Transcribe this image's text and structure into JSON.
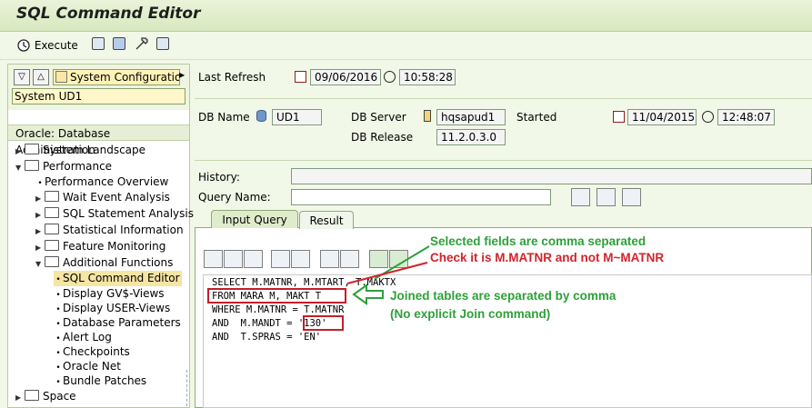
{
  "app": {
    "title": "SQL Command Editor"
  },
  "toolbar": {
    "execute_label": "Execute"
  },
  "nav": {
    "system_config": "System Configuratio",
    "system_selected": "System UD1",
    "header": "Oracle: Database Administration",
    "tree": [
      {
        "label": "System Landscape"
      },
      {
        "label": "Performance"
      },
      {
        "label": "Performance Overview"
      },
      {
        "label": "Wait Event Analysis"
      },
      {
        "label": "SQL Statement Analysis"
      },
      {
        "label": "Statistical Information"
      },
      {
        "label": "Feature Monitoring"
      },
      {
        "label": "Additional Functions"
      },
      {
        "label": "SQL Command Editor"
      },
      {
        "label": "Display GV$-Views"
      },
      {
        "label": "Display USER-Views"
      },
      {
        "label": "Database Parameters"
      },
      {
        "label": "Alert Log"
      },
      {
        "label": "Checkpoints"
      },
      {
        "label": "Oracle Net"
      },
      {
        "label": "Bundle Patches"
      },
      {
        "label": "Space"
      }
    ]
  },
  "info": {
    "last_refresh_label": "Last Refresh",
    "last_refresh_date": "09/06/2016",
    "last_refresh_time": "10:58:28",
    "db_name_label": "DB Name",
    "db_name": "UD1",
    "db_server_label": "DB Server",
    "db_server": "hqsapud1",
    "started_label": "Started",
    "started_date": "11/04/2015",
    "started_time": "12:48:07",
    "db_release_label": "DB Release",
    "db_release": "11.2.0.3.0",
    "history_label": "History:",
    "history_value": "",
    "query_name_label": "Query Name:",
    "query_name_value": ""
  },
  "tabs": [
    {
      "label": "Input Query"
    },
    {
      "label": "Result"
    }
  ],
  "sql_lines": [
    "SELECT M.MATNR, M.MTART, T.MAKTX",
    "FROM MARA M, MAKT T",
    "WHERE M.MATNR = T.MATNR",
    "AND  M.MANDT = '130'",
    "AND  T.SPRAS = 'EN'"
  ],
  "annotations": {
    "comma_fields": "Selected fields are comma separated",
    "check_matnr": "Check it is M.MATNR and not M~MATNR",
    "joined_tables": "Joined tables are separated by comma",
    "no_join": "(No explicit Join command)"
  },
  "colors": {
    "annotation_green": "#2ea03a",
    "annotation_red": "#d2232a",
    "selected_bg": "#f6e5a3"
  }
}
